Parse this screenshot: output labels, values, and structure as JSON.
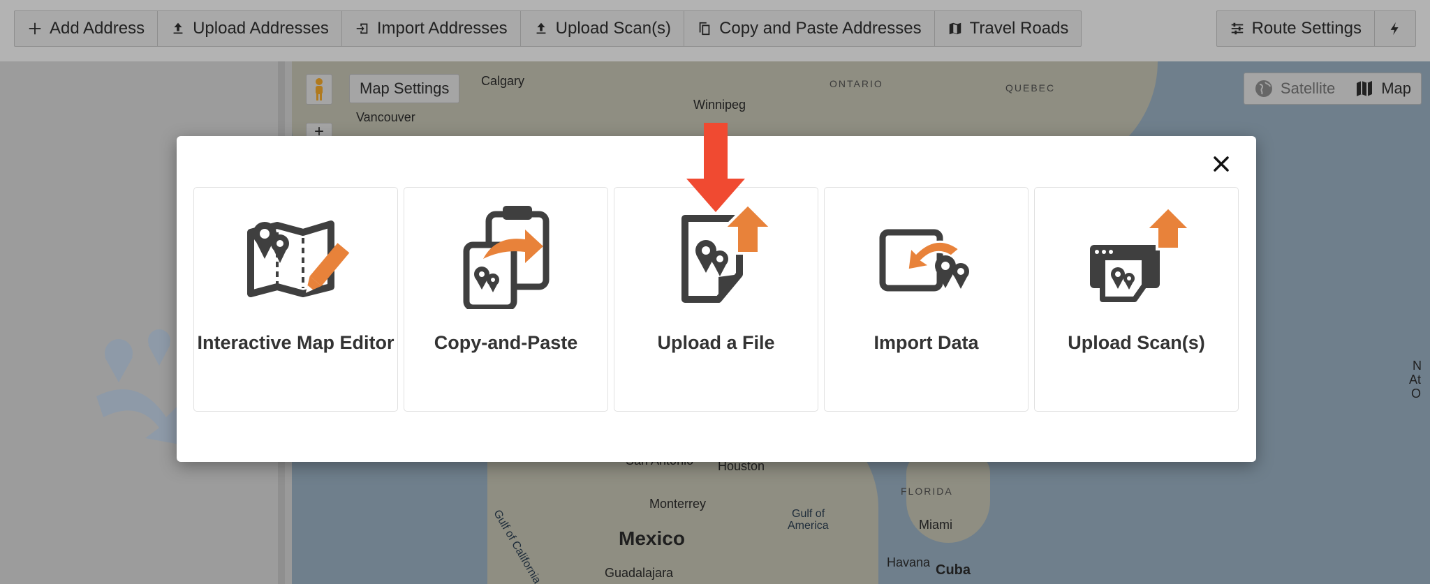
{
  "toolbar": {
    "left": [
      {
        "label": "Add Address",
        "icon": "plus-icon"
      },
      {
        "label": "Upload Addresses",
        "icon": "upload-icon"
      },
      {
        "label": "Import Addresses",
        "icon": "import-icon"
      },
      {
        "label": "Upload Scan(s)",
        "icon": "upload-icon"
      },
      {
        "label": "Copy and Paste Addresses",
        "icon": "copy-icon"
      },
      {
        "label": "Travel Roads",
        "icon": "map-icon"
      }
    ],
    "right": [
      {
        "label": "Route Settings",
        "icon": "sliders-icon"
      }
    ],
    "bolt_icon": "lightning-icon"
  },
  "map": {
    "settings_label": "Map Settings",
    "type_satellite": "Satellite",
    "type_map": "Map",
    "labels": {
      "calgary": "Calgary",
      "vancouver": "Vancouver",
      "winnipeg": "Winnipeg",
      "ontario": "ONTARIO",
      "quebec": "QUEBEC",
      "san_antonio": "San Antonio",
      "houston": "Houston",
      "gulf_of_california": "Gulf of California",
      "monterrey": "Monterrey",
      "mexico": "Mexico",
      "guadalajara": "Guadalajara",
      "gulf_of_america_1": "Gulf of",
      "gulf_of_america_2": "America",
      "florida": "FLORIDA",
      "miami": "Miami",
      "havana": "Havana",
      "cuba": "Cuba",
      "edge_1": "N",
      "edge_2": "At",
      "edge_3": "O"
    }
  },
  "modal": {
    "close_icon": "close-icon",
    "options": [
      {
        "label": "Interactive Map Editor",
        "icon": "map-editor-icon"
      },
      {
        "label": "Copy-and-Paste",
        "icon": "clipboard-icon"
      },
      {
        "label": "Upload a File",
        "icon": "file-upload-icon"
      },
      {
        "label": "Import Data",
        "icon": "import-data-icon"
      },
      {
        "label": "Upload Scan(s)",
        "icon": "scan-upload-icon"
      }
    ]
  },
  "colors": {
    "accent_orange": "#e8823a",
    "icon_dark": "#3f3f3f",
    "highlight_arrow": "#f04a31"
  }
}
